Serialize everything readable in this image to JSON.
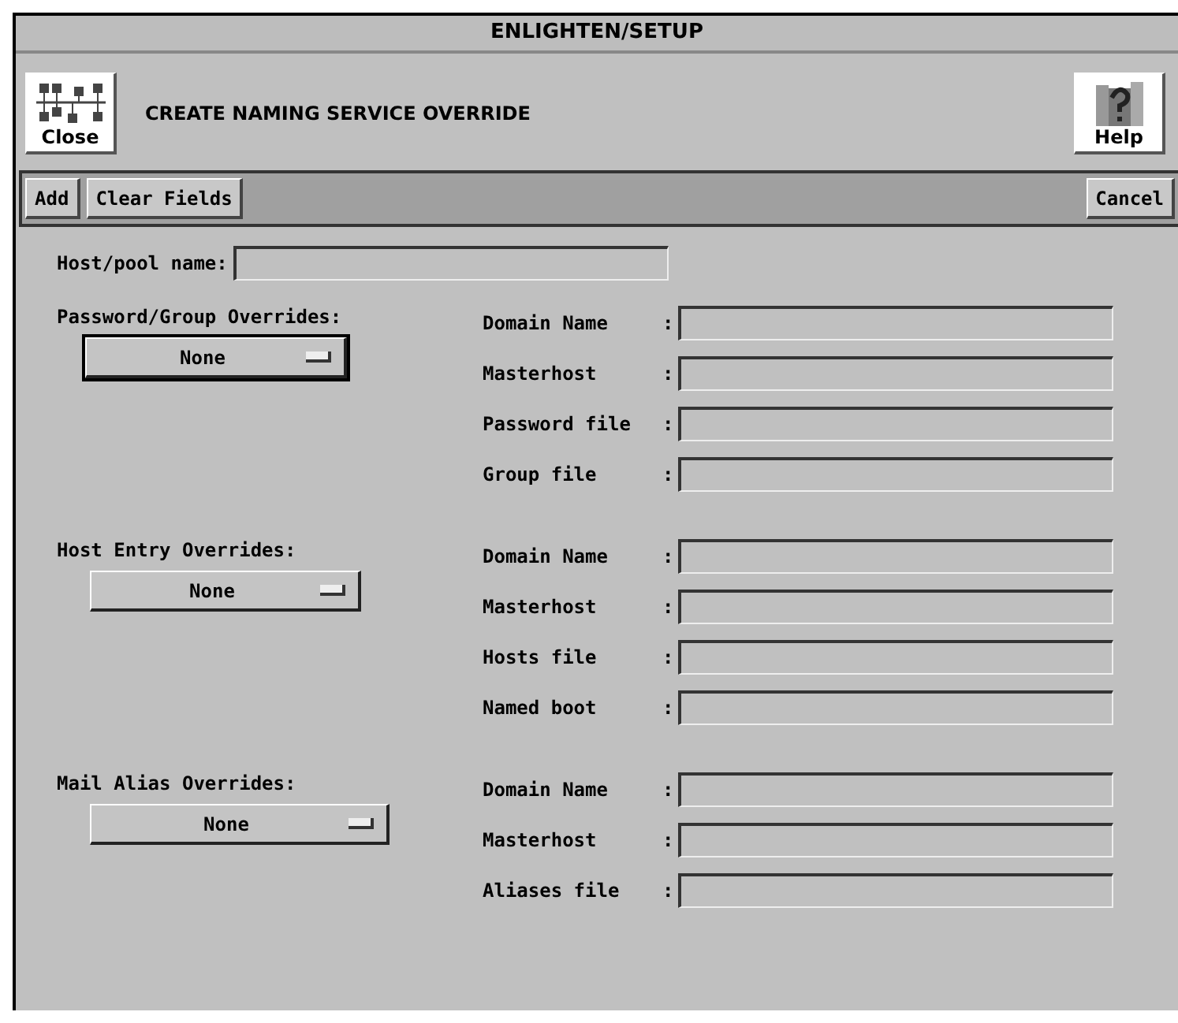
{
  "window": {
    "title": "ENLIGHTEN/SETUP"
  },
  "header": {
    "close_label": "Close",
    "title": "CREATE NAMING SERVICE OVERRIDE",
    "help_label": "Help"
  },
  "toolbar": {
    "left_buttons": [
      "Add",
      "Clear Fields"
    ],
    "right_buttons": [
      "Cancel"
    ]
  },
  "host_pool": {
    "label": "Host/pool name:"
  },
  "sections": [
    {
      "label": "Password/Group Overrides:",
      "dropdown": "None",
      "focused": true,
      "fields": [
        {
          "label": "Domain Name",
          "separator": ":"
        },
        {
          "label": "Masterhost",
          "separator": ":"
        },
        {
          "label": "Password file",
          "separator": ":"
        },
        {
          "label": "Group file",
          "separator": ":"
        }
      ]
    },
    {
      "label": "Host Entry Overrides:",
      "dropdown": "None",
      "focused": false,
      "fields": [
        {
          "label": "Domain Name",
          "separator": ":"
        },
        {
          "label": "Masterhost",
          "separator": ":"
        },
        {
          "label": "Hosts file",
          "separator": ":"
        },
        {
          "label": "Named boot",
          "separator": ":"
        }
      ]
    },
    {
      "label": "Mail Alias Overrides:",
      "dropdown": "None",
      "focused": false,
      "fields": [
        {
          "label": "Domain Name",
          "separator": ":"
        },
        {
          "label": "Masterhost",
          "separator": ":"
        },
        {
          "label": "Aliases file",
          "separator": ":"
        }
      ]
    }
  ]
}
